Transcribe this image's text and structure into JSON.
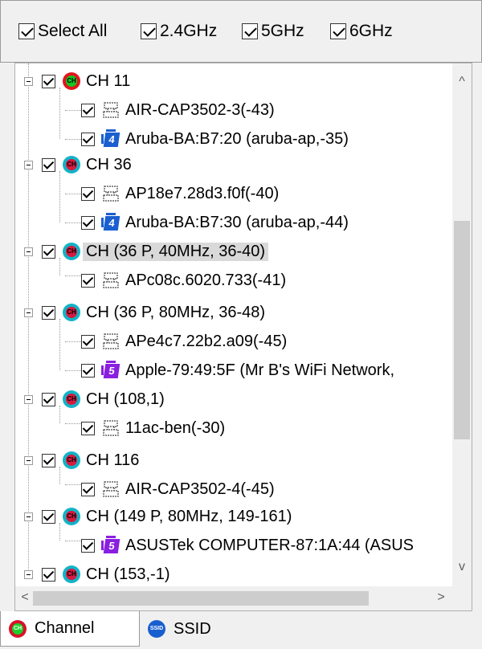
{
  "filters": [
    {
      "label": "Select All",
      "checked": true
    },
    {
      "label": "2.4GHz",
      "checked": true
    },
    {
      "label": "5GHz",
      "checked": true
    },
    {
      "label": "6GHz",
      "checked": true
    }
  ],
  "tree": {
    "nodes": [
      {
        "label": "CH 11",
        "icon_text": "CH"
      },
      {
        "label": "AIR-CAP3502-3(-43)"
      },
      {
        "label": "Aruba-BA:B7:20 (aruba-ap,-35)",
        "icon_text": "4"
      },
      {
        "label": "CH 36",
        "icon_text": "CH"
      },
      {
        "label": "AP18e7.28d3.f0f(-40)"
      },
      {
        "label": "Aruba-BA:B7:30 (aruba-ap,-44)",
        "icon_text": "4"
      },
      {
        "label": "CH (36 P, 40MHz, 36-40)",
        "icon_text": "CH"
      },
      {
        "label": "APc08c.6020.733(-41)"
      },
      {
        "label": "CH (36 P, 80MHz, 36-48)",
        "icon_text": "CH"
      },
      {
        "label": "APe4c7.22b2.a09(-45)"
      },
      {
        "label": "Apple-79:49:5F (Mr B's WiFi Network,",
        "icon_text": "5"
      },
      {
        "label": "CH (108,1)",
        "icon_text": "CH"
      },
      {
        "label": "11ac-ben(-30)"
      },
      {
        "label": "CH 116",
        "icon_text": "CH"
      },
      {
        "label": "AIR-CAP3502-4(-45)"
      },
      {
        "label": "CH (149 P, 80MHz, 149-161)",
        "icon_text": "CH"
      },
      {
        "label": "ASUSTek COMPUTER-87:1A:44 (ASUS",
        "icon_text": "5"
      },
      {
        "label": "CH (153,-1)",
        "icon_text": "CH"
      }
    ]
  },
  "scroll": {
    "up": "^",
    "down": "v",
    "left": "<",
    "right": ">"
  },
  "tabs": [
    {
      "label": "Channel",
      "icon_text": "CH",
      "active": true
    },
    {
      "label": "SSID",
      "icon_text": "SSID",
      "active": false
    }
  ],
  "colors": {
    "wifi4_blue": "#1a5fd0",
    "wifi5_purple": "#8a1fe0",
    "channel_red": "#e3141e",
    "channel_cyan": "#12b3c7"
  },
  "icons": {
    "channel": "channel-icon",
    "access_point": "access-point-icon",
    "wifi4": "wifi-4-icon",
    "wifi5": "wifi-5-icon"
  }
}
